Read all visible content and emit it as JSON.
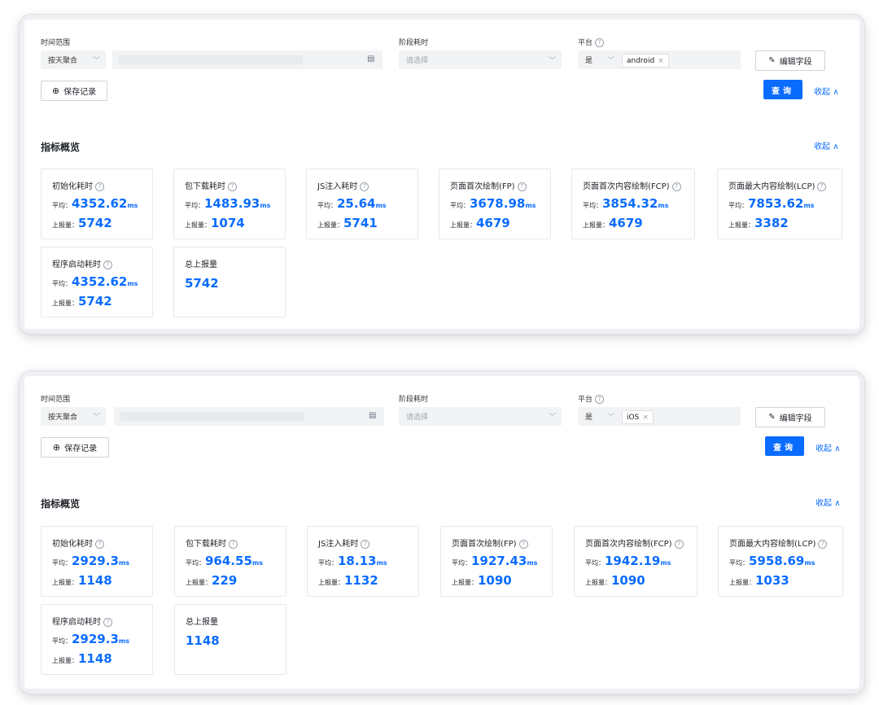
{
  "common": {
    "time_range_label": "时间范围",
    "aggregate": "按天聚合",
    "stage_label": "阶段耗时",
    "stage_placeholder": "请选择",
    "platform_label": "平台",
    "platform_op": "是",
    "edit_fields": "编辑字段",
    "save_record": "保存记录",
    "query": "查询",
    "collapse": "收起",
    "metrics_title": "指标概览",
    "avg_label": "平均：",
    "count_label": "上报量：",
    "unit": "ms",
    "total_label": "总上报量",
    "accent": "#0a6cff"
  },
  "panels": [
    {
      "platform_tag": "android",
      "metrics": [
        {
          "name": "初始化耗时",
          "avg": "4352.62",
          "count": "5742"
        },
        {
          "name": "包下载耗时",
          "avg": "1483.93",
          "count": "1074"
        },
        {
          "name": "JS注入耗时",
          "avg": "25.64",
          "count": "5741"
        },
        {
          "name": "页面首次绘制(FP)",
          "avg": "3678.98",
          "count": "4679"
        },
        {
          "name": "页面首次内容绘制(FCP)",
          "avg": "3854.32",
          "count": "4679"
        },
        {
          "name": "页面最大内容绘制(LCP)",
          "avg": "7853.62",
          "count": "3382"
        },
        {
          "name": "程序启动耗时",
          "avg": "4352.62",
          "count": "5742"
        }
      ],
      "total": "5742"
    },
    {
      "platform_tag": "iOS",
      "metrics": [
        {
          "name": "初始化耗时",
          "avg": "2929.3",
          "count": "1148"
        },
        {
          "name": "包下载耗时",
          "avg": "964.55",
          "count": "229"
        },
        {
          "name": "JS注入耗时",
          "avg": "18.13",
          "count": "1132"
        },
        {
          "name": "页面首次绘制(FP)",
          "avg": "1927.43",
          "count": "1090"
        },
        {
          "name": "页面首次内容绘制(FCP)",
          "avg": "1942.19",
          "count": "1090"
        },
        {
          "name": "页面最大内容绘制(LCP)",
          "avg": "5958.69",
          "count": "1033"
        },
        {
          "name": "程序启动耗时",
          "avg": "2929.3",
          "count": "1148"
        }
      ],
      "total": "1148"
    }
  ]
}
